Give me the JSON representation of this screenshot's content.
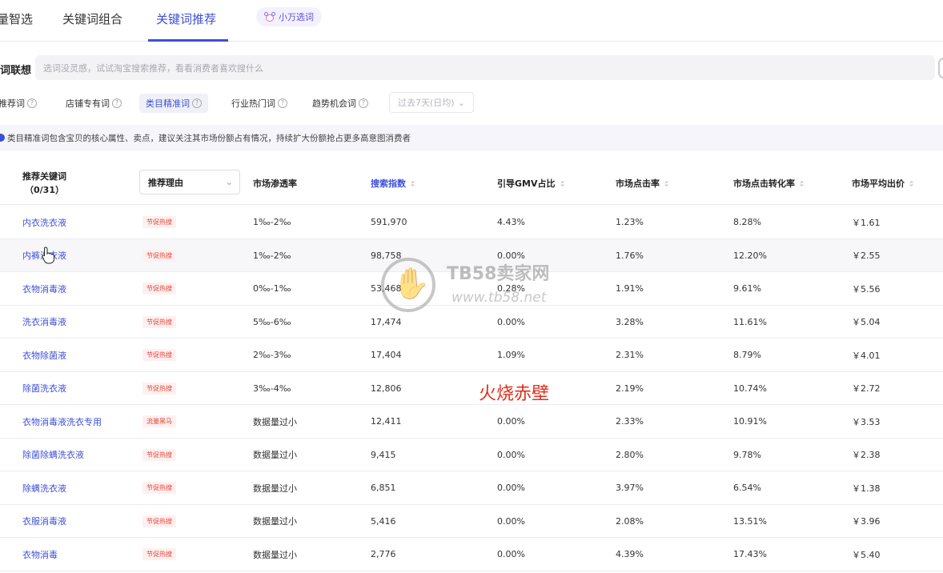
{
  "tabs": [
    "量智选",
    "关键词组合",
    "关键词推荐"
  ],
  "active_tab": "关键词推荐",
  "xiaowan_label": "小万选词",
  "search": {
    "label": "词联想",
    "placeholder": "选词没灵感，试试淘宝搜索推荐，看看消费者喜欢搜什么"
  },
  "filters": [
    "推荐词",
    "店铺专有词",
    "类目精准词",
    "行业热门词",
    "趋势机会词"
  ],
  "active_filter": "类目精准词",
  "period": "过去7天(日均)",
  "notice": "类目精准词包含宝贝的核心属性、卖点，建议关注其市场份额占有情况，持续扩大份额抢占更多高意图消费者",
  "columns": {
    "keyword": "推荐关键词",
    "count": "（0/31）",
    "reason": "推荐理由",
    "penetration": "市场渗透率",
    "search_index": "搜索指数",
    "gmv_share": "引导GMV占比",
    "ctr": "市场点击率",
    "cvr": "市场点击转化率",
    "avg_bid": "市场平均出价"
  },
  "rows": [
    {
      "keyword": "内衣洗衣液",
      "tag": "节促热搜",
      "penetration": "1‰-2‰",
      "search_index": "591,970",
      "gmv_share": "4.43%",
      "ctr": "1.23%",
      "cvr": "8.28%",
      "avg_bid": "￥1.61"
    },
    {
      "keyword": "内裤洗衣液",
      "tag": "节促热搜",
      "penetration": "1‰-2‰",
      "search_index": "98,758",
      "gmv_share": "0.00%",
      "ctr": "1.76%",
      "cvr": "12.20%",
      "avg_bid": "￥2.55"
    },
    {
      "keyword": "衣物消毒液",
      "tag": "节促热搜",
      "penetration": "0‰-1‰",
      "search_index": "53,468",
      "gmv_share": "0.28%",
      "ctr": "1.91%",
      "cvr": "9.61%",
      "avg_bid": "￥5.56"
    },
    {
      "keyword": "洗衣消毒液",
      "tag": "节促热搜",
      "penetration": "5‰-6‰",
      "search_index": "17,474",
      "gmv_share": "0.00%",
      "ctr": "3.28%",
      "cvr": "11.61%",
      "avg_bid": "￥5.04"
    },
    {
      "keyword": "衣物除菌液",
      "tag": "节促热搜",
      "penetration": "2‰-3‰",
      "search_index": "17,404",
      "gmv_share": "1.09%",
      "ctr": "2.31%",
      "cvr": "8.79%",
      "avg_bid": "￥4.01"
    },
    {
      "keyword": "除菌洗衣液",
      "tag": "节促热搜",
      "penetration": "3‰-4‰",
      "search_index": "12,806",
      "gmv_share": "",
      "ctr": "2.19%",
      "cvr": "10.74%",
      "avg_bid": "￥2.72"
    },
    {
      "keyword": "衣物消毒液洗衣专用",
      "tag": "流量黑马",
      "penetration": "数据量过小",
      "search_index": "12,411",
      "gmv_share": "0.00%",
      "ctr": "2.33%",
      "cvr": "10.91%",
      "avg_bid": "￥3.53"
    },
    {
      "keyword": "除菌除螨洗衣液",
      "tag": "节促热搜",
      "penetration": "数据量过小",
      "search_index": "9,415",
      "gmv_share": "0.00%",
      "ctr": "2.80%",
      "cvr": "9.78%",
      "avg_bid": "￥2.38"
    },
    {
      "keyword": "除螨洗衣液",
      "tag": "节促热搜",
      "penetration": "数据量过小",
      "search_index": "6,851",
      "gmv_share": "0.00%",
      "ctr": "3.97%",
      "cvr": "6.54%",
      "avg_bid": "￥1.38"
    },
    {
      "keyword": "衣服消毒液",
      "tag": "节促热搜",
      "penetration": "数据量过小",
      "search_index": "5,416",
      "gmv_share": "0.00%",
      "ctr": "2.08%",
      "cvr": "13.51%",
      "avg_bid": "￥3.96"
    },
    {
      "keyword": "衣物消毒",
      "tag": "节促热搜",
      "penetration": "数据量过小",
      "search_index": "2,776",
      "gmv_share": "0.00%",
      "ctr": "4.39%",
      "cvr": "17.43%",
      "avg_bid": "￥5.40"
    }
  ],
  "watermark": {
    "title": "TB58卖家网",
    "url": "www.tb58.net"
  },
  "overlay_text": "火烧赤壁",
  "colors": {
    "accent": "#3d4fd8",
    "tag_red": "#e0453a",
    "overlay_red": "#e0301e"
  }
}
